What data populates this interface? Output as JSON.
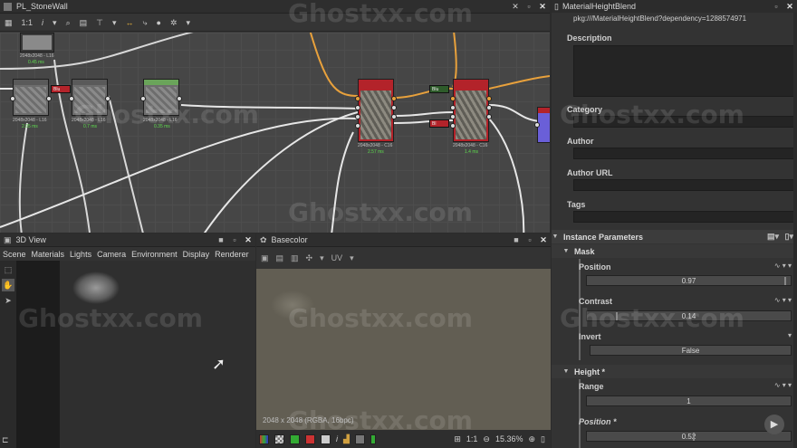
{
  "graph": {
    "title": "PL_StoneWall",
    "toolbar": {
      "zoom_label": "1:1",
      "info": "i"
    },
    "nodes": [
      {
        "label": "2048x2048 - L16",
        "time": "0.45 ms"
      },
      {
        "label": "2048x2048 - L16",
        "time": "2.05 ms"
      },
      {
        "label": "2048x2048 - L16",
        "time": "0.7 ms"
      },
      {
        "label": "2048x2048 - L16",
        "time": "0.35 ms"
      },
      {
        "label": "2048x2048 - C16",
        "time": "2.57 ms"
      },
      {
        "label": "2048x2048 - C16",
        "time": "1.4 ms"
      }
    ],
    "mini_nodes": [
      "Blu",
      "Blu",
      "Bl"
    ]
  },
  "view3d": {
    "title": "3D View",
    "menu": [
      "Scene",
      "Materials",
      "Lights",
      "Camera",
      "Environment",
      "Display",
      "Renderer"
    ]
  },
  "view2d": {
    "title": "Basecolor",
    "uv_label": "UV",
    "resolution": "2048 x 2048 (RGBA, 16bpc)",
    "zoom_ratio": "1:1",
    "zoom": "15.36%"
  },
  "props": {
    "title": "MaterialHeightBlend",
    "pkg": "pkg:///MaterialHeightBlend?dependency=1288574971",
    "sections": {
      "description": "Description",
      "category": "Category",
      "author": "Author",
      "author_url": "Author URL",
      "tags": "Tags"
    },
    "instance_params": "Instance Parameters",
    "mask_group": "Mask",
    "height_group": "Height *",
    "params": {
      "position": {
        "label": "Position",
        "value": "0.97",
        "level": 0.97
      },
      "contrast": {
        "label": "Contrast",
        "value": "0.14",
        "level": 0.14
      },
      "invert": {
        "label": "Invert",
        "value": "False"
      },
      "range": {
        "label": "Range",
        "value": "1"
      },
      "height_position": {
        "label": "Position *",
        "value": "0.52",
        "level": 0.52
      }
    }
  },
  "watermark": "Ghostxx.com",
  "colors": {
    "time_green": "#5fdc4f",
    "node_red": "#b3232a",
    "wire_orange": "#e8a13c"
  }
}
